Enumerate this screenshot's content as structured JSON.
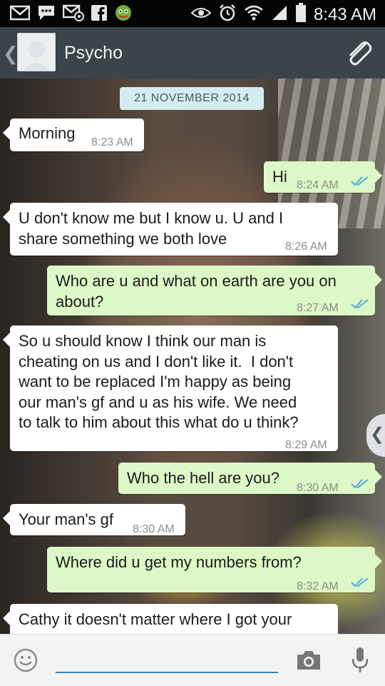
{
  "status_bar": {
    "time": "8:43 AM",
    "left_icons": [
      "mail-icon",
      "sms-icon",
      "email-at-icon",
      "facebook-icon",
      "game-notification-icon"
    ],
    "right_icons": [
      "eye-icon",
      "alarm-icon",
      "wifi-icon",
      "signal-icon",
      "battery-icon"
    ]
  },
  "header": {
    "contact_name": "Psycho",
    "back_icon": "chevron-left-icon",
    "avatar_icon": "default-avatar-icon",
    "attach_icon": "paperclip-icon"
  },
  "date_separator": "21 NOVEMBER 2014",
  "messages": [
    {
      "direction": "in",
      "text": "Morning",
      "time": "8:23 AM"
    },
    {
      "direction": "out",
      "text": "Hi",
      "time": "8:24 AM",
      "ticks": "read"
    },
    {
      "direction": "in",
      "text": "U don't know me but I know u. U and I\nshare something we both love",
      "time": "8:26 AM"
    },
    {
      "direction": "out",
      "text": "Who are u and what on earth are you on\nabout?",
      "time": "8:27 AM",
      "ticks": "read"
    },
    {
      "direction": "in",
      "text": "So u should know I think our man is\ncheating on us and I don't like it.  I don't\nwant to be replaced I'm happy as being\nour man's gf and u as his wife. We need\nto talk to him about this what do u think?",
      "time": "8:29 AM"
    },
    {
      "direction": "out",
      "text": "Who the hell are you?",
      "time": "8:30 AM",
      "ticks": "read"
    },
    {
      "direction": "in",
      "text": "Your man's gf",
      "time": "8:30 AM"
    },
    {
      "direction": "out",
      "text": "Where did u get my numbers from?",
      "time": "8:32 AM",
      "ticks": "read"
    },
    {
      "direction": "in",
      "text": "Cathy it doesn't matter where I got your",
      "time": ""
    }
  ],
  "composer": {
    "emoji_icon": "smiley-icon",
    "input_value": "",
    "camera_icon": "camera-icon",
    "mic_icon": "microphone-icon"
  },
  "colors": {
    "incoming_bubble": "#ffffff",
    "outgoing_bubble": "#dcf8c6",
    "read_ticks": "#4fa8e0",
    "action_bar": "#3a4449",
    "date_chip": "#d2ecf2",
    "input_underline": "#2a86c8"
  }
}
